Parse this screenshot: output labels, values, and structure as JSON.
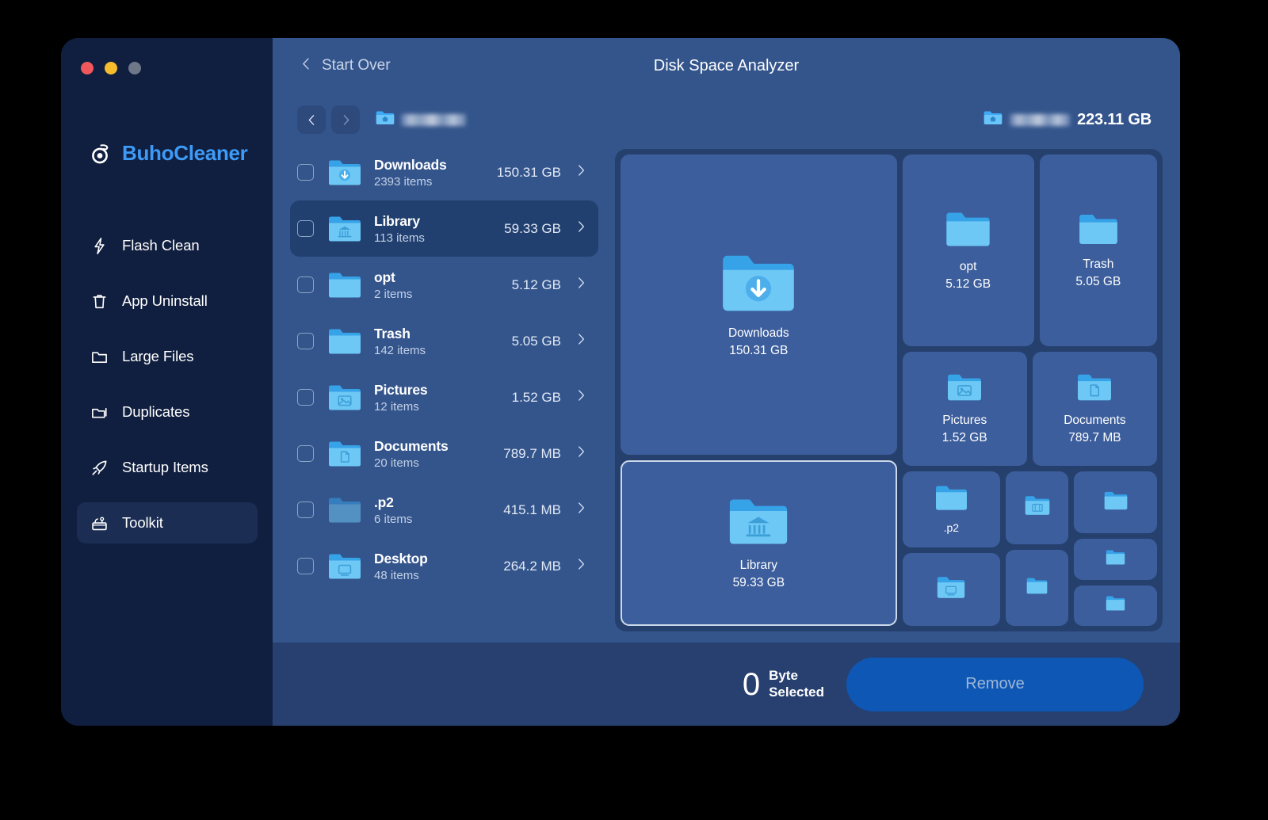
{
  "window": {
    "traffic_lights": [
      "close",
      "minimize",
      "zoom"
    ]
  },
  "brand": {
    "name": "BuhoCleaner",
    "logo_icon": "owl-logo-icon"
  },
  "sidebar": {
    "items": [
      {
        "label": "Flash Clean",
        "icon": "bolt-icon",
        "active": false
      },
      {
        "label": "App Uninstall",
        "icon": "trash-icon",
        "active": false
      },
      {
        "label": "Large Files",
        "icon": "folder-icon",
        "active": false
      },
      {
        "label": "Duplicates",
        "icon": "copy-folder-icon",
        "active": false
      },
      {
        "label": "Startup Items",
        "icon": "rocket-icon",
        "active": false
      },
      {
        "label": "Toolkit",
        "icon": "toolbox-icon",
        "active": true
      }
    ]
  },
  "topbar": {
    "back_label": "Start Over",
    "back_icon": "chevron-left-icon",
    "title": "Disk Space Analyzer"
  },
  "crumbbar": {
    "back_icon": "chevron-left-icon",
    "forward_icon": "chevron-right-icon",
    "home_icon": "home-folder-icon",
    "path_redacted": true,
    "disk_icon": "home-folder-icon",
    "disk_total": "223.11 GB"
  },
  "filelist": {
    "rows": [
      {
        "name": "Downloads",
        "items": "2393 items",
        "size": "150.31 GB",
        "icon": "downloads-folder-icon",
        "selected": false,
        "hidden": false
      },
      {
        "name": "Library",
        "items": "113 items",
        "size": "59.33 GB",
        "icon": "library-folder-icon",
        "selected": true,
        "hidden": false
      },
      {
        "name": "opt",
        "items": "2 items",
        "size": "5.12 GB",
        "icon": "plain-folder-icon",
        "selected": false,
        "hidden": false
      },
      {
        "name": "Trash",
        "items": "142 items",
        "size": "5.05 GB",
        "icon": "plain-folder-icon",
        "selected": false,
        "hidden": false
      },
      {
        "name": "Pictures",
        "items": "12 items",
        "size": "1.52 GB",
        "icon": "pictures-folder-icon",
        "selected": false,
        "hidden": false
      },
      {
        "name": "Documents",
        "items": "20 items",
        "size": "789.7 MB",
        "icon": "documents-folder-icon",
        "selected": false,
        "hidden": false
      },
      {
        "name": ".p2",
        "items": "6 items",
        "size": "415.1 MB",
        "icon": "plain-folder-icon",
        "selected": false,
        "hidden": true
      },
      {
        "name": "Desktop",
        "items": "48 items",
        "size": "264.2 MB",
        "icon": "desktop-folder-icon",
        "selected": false,
        "hidden": false
      }
    ]
  },
  "treemap": {
    "tiles": [
      {
        "label": "Downloads",
        "size": "150.31 GB",
        "icon": "downloads-folder-icon",
        "selected": false
      },
      {
        "label": "Library",
        "size": "59.33 GB",
        "icon": "library-folder-icon",
        "selected": true
      },
      {
        "label": "opt",
        "size": "5.12 GB",
        "icon": "plain-folder-icon",
        "selected": false
      },
      {
        "label": "Trash",
        "size": "5.05 GB",
        "icon": "plain-folder-icon",
        "selected": false
      },
      {
        "label": "Pictures",
        "size": "1.52 GB",
        "icon": "pictures-folder-icon",
        "selected": false
      },
      {
        "label": "Documents",
        "size": "789.7 MB",
        "icon": "documents-folder-icon",
        "selected": false
      },
      {
        "label": ".p2",
        "size": "",
        "icon": "plain-folder-icon",
        "selected": false
      },
      {
        "label": "",
        "size": "",
        "icon": "movies-folder-icon",
        "selected": false
      },
      {
        "label": "",
        "size": "",
        "icon": "plain-folder-icon",
        "selected": false
      },
      {
        "label": "",
        "size": "",
        "icon": "desktop-folder-icon",
        "selected": false
      },
      {
        "label": "",
        "size": "",
        "icon": "plain-folder-icon",
        "selected": false
      },
      {
        "label": "",
        "size": "",
        "icon": "plain-folder-icon",
        "selected": false
      },
      {
        "label": "",
        "size": "",
        "icon": "plain-folder-icon",
        "selected": false
      }
    ]
  },
  "bottombar": {
    "selected_number": "0",
    "selected_unit": "Byte",
    "selected_word": "Selected",
    "remove_label": "Remove"
  },
  "colors": {
    "sidebar_bg": "#101f3f",
    "main_bg": "#34558c",
    "treemap_bg": "#26406e",
    "tile_bg": "#3c5e9c",
    "accent": "#3d9bf7",
    "remove_btn": "#0e57b5",
    "bottom_bg": "#27406f"
  }
}
